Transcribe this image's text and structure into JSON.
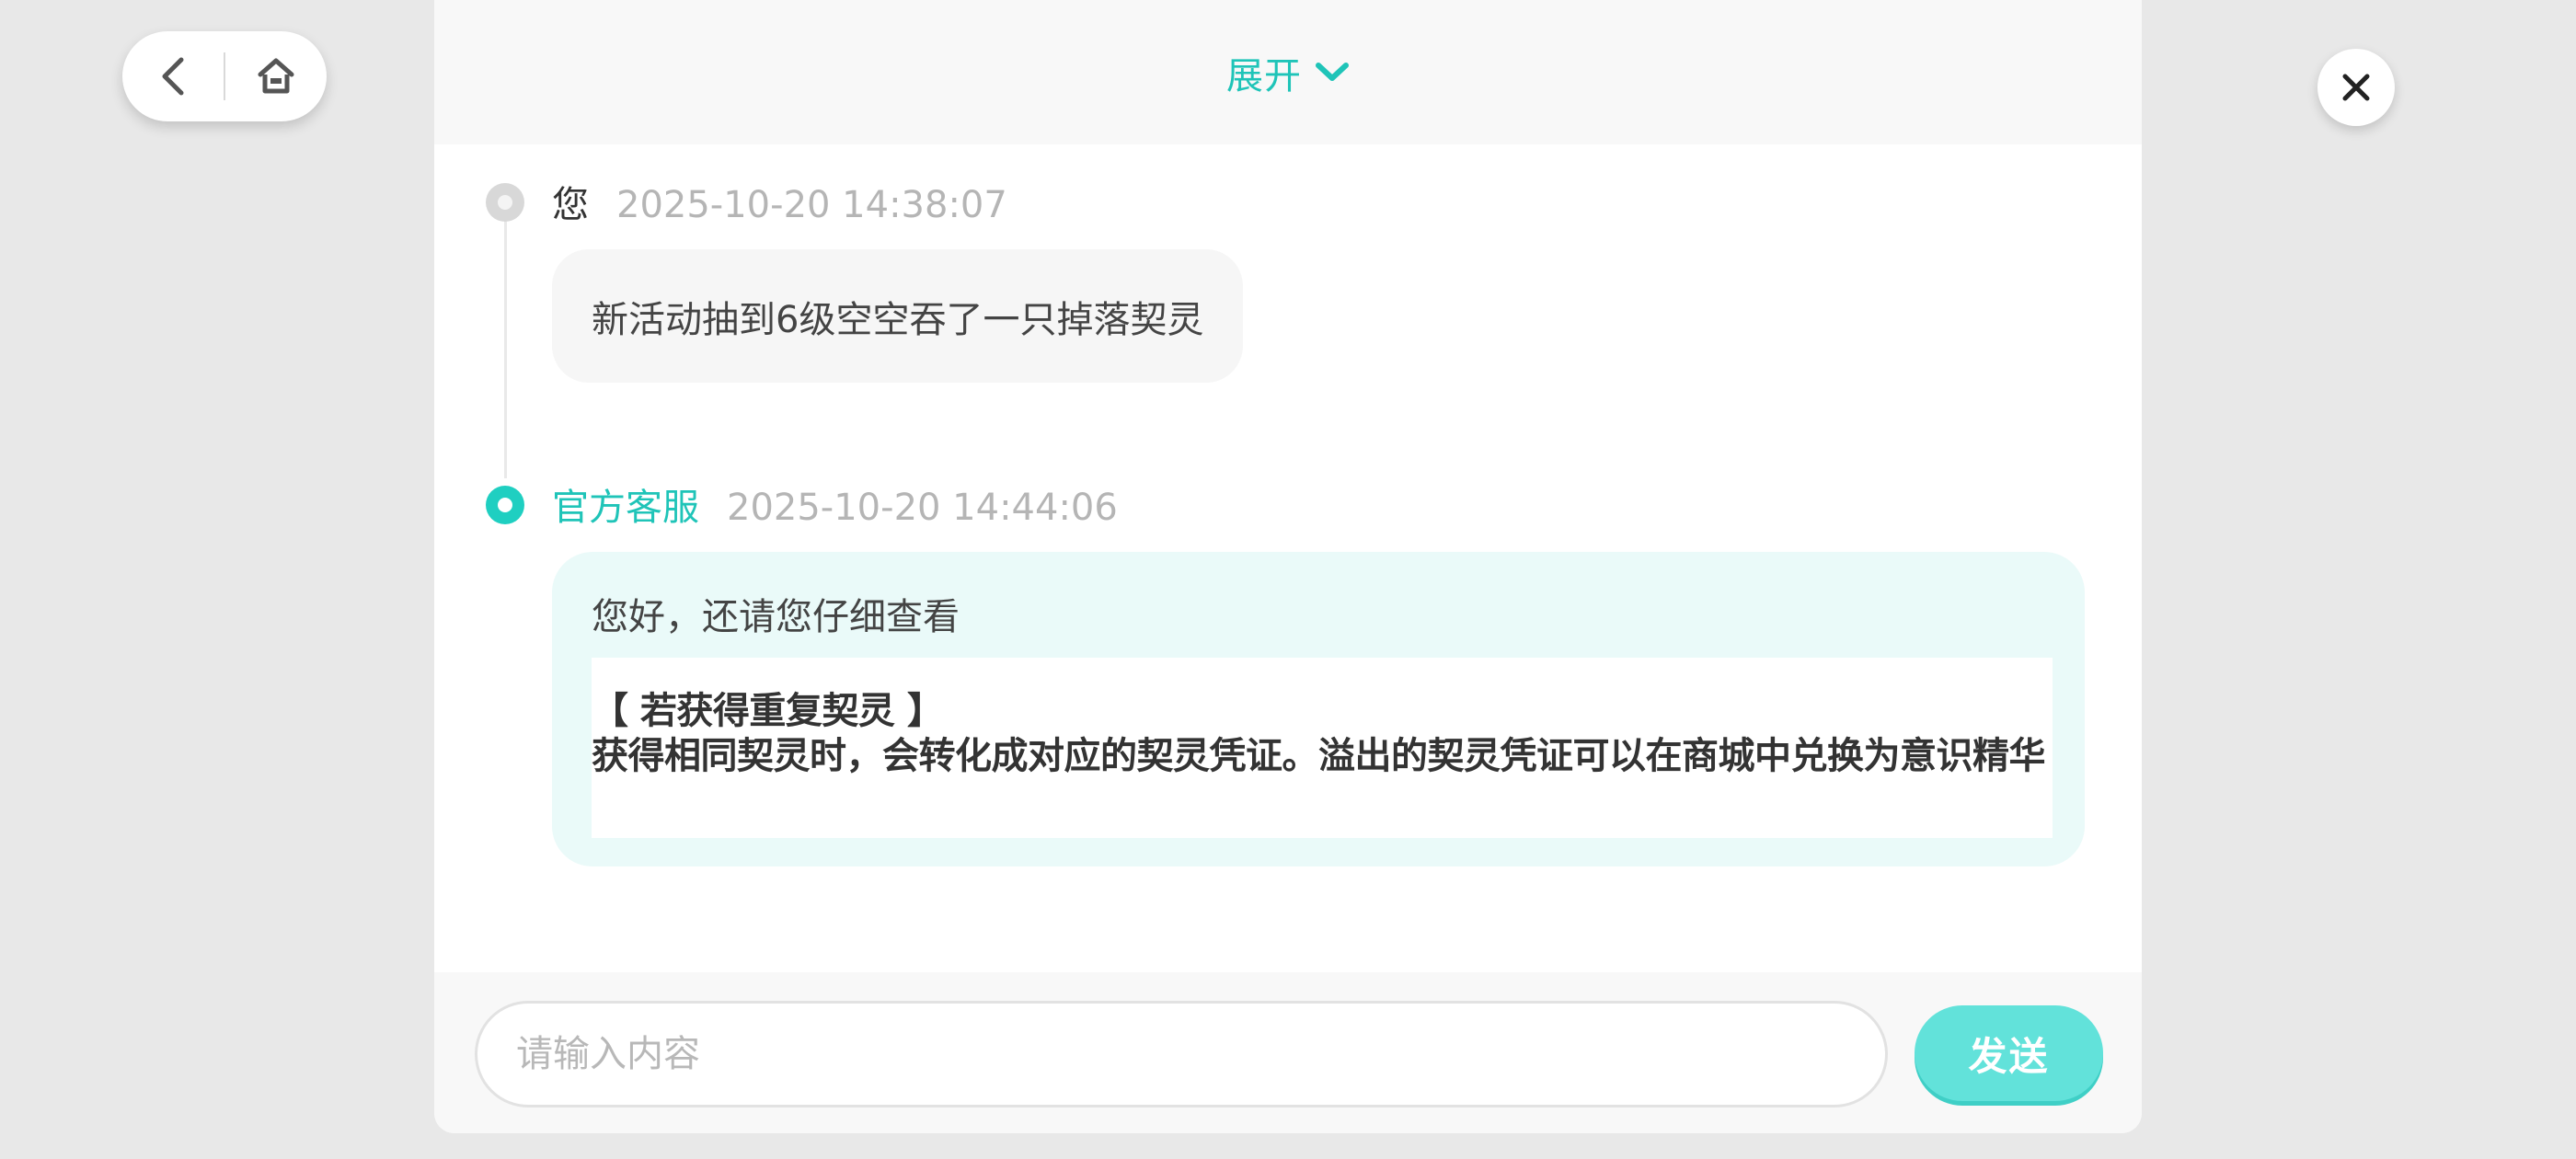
{
  "nav": {
    "back_icon": "chevron-left-icon",
    "home_icon": "home-icon"
  },
  "close": {
    "icon": "close-icon"
  },
  "panel": {
    "expand_label": "展开",
    "expand_icon": "chevron-down-icon"
  },
  "messages": [
    {
      "sender": "您",
      "timestamp": "2025-10-20 14:38:07",
      "text": "新活动抽到6级空空吞了一只掉落契灵"
    },
    {
      "sender": "官方客服",
      "timestamp": "2025-10-20 14:44:06",
      "greeting": "您好，还请您仔细查看",
      "notice_title": "【 若获得重复契灵 】",
      "notice_body": "获得相同契灵时，会转化成对应的契灵凭证。溢出的契灵凭证可以在商城中兑换为意识精华"
    }
  ],
  "input": {
    "placeholder": "请输入内容",
    "value": ""
  },
  "send_button": {
    "label": "发送"
  },
  "colors": {
    "accent": "#1fc4b8",
    "send_button": "#62e2da",
    "agent_bubble": "#eafaf9",
    "background": "#e8e8e8"
  }
}
